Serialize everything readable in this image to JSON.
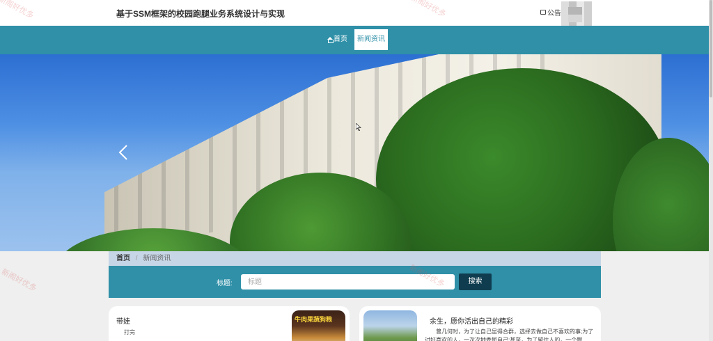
{
  "header": {
    "site_title": "基于SSM框架的校园跑腿业务系统设计与实现",
    "notice_label": "公告"
  },
  "nav": {
    "items": [
      {
        "label": "首页",
        "active": false
      },
      {
        "label": "新闻资讯",
        "active": true
      }
    ]
  },
  "breadcrumb": {
    "home": "首页",
    "separator": "/",
    "current": "新闻资讯"
  },
  "search": {
    "label": "标题:",
    "placeholder": "标题",
    "button_label": "搜索"
  },
  "news": [
    {
      "title": "带娃",
      "subtitle": "打完",
      "image_text": "牛肉果蔬狗粮"
    },
    {
      "title": "余生，愿你活出自己的精彩",
      "excerpt": "曾几何时，为了让自己显得合群，选择去做自己不喜欢的事;为了讨好喜欢的人，一次次地委屈自己;甚至，为了留住人的，一个眼"
    }
  ],
  "watermark": {
    "text": "新阁好优多"
  },
  "colors": {
    "nav_bg": "#2f90a8",
    "search_btn_bg": "#0f3d4f",
    "breadcrumb_bg": "#c7d6e6",
    "page_bg": "#efefef"
  },
  "icons": {
    "notice": "message-square-icon",
    "home": "home-icon",
    "carousel_prev": "chevron-left-icon"
  }
}
